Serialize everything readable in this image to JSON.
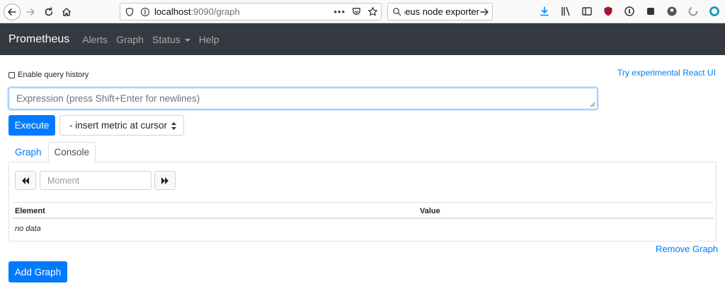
{
  "browser": {
    "url_host": "localhost",
    "url_path": ":9090/graph",
    "url_dots": "•••",
    "search_text": "theus node exporter"
  },
  "navbar": {
    "brand": "Prometheus",
    "links": [
      "Alerts",
      "Graph",
      "Status",
      "Help"
    ]
  },
  "page": {
    "query_history_label": "Enable query history",
    "react_link": "Try experimental React UI",
    "expression_placeholder": "Expression (press Shift+Enter for newlines)",
    "execute_label": "Execute",
    "metric_select_label": "- insert metric at cursor",
    "tabs": [
      "Graph",
      "Console"
    ],
    "active_tab": "Console",
    "moment_placeholder": "Moment",
    "table": {
      "columns": [
        "Element",
        "Value"
      ],
      "empty_text": "no data"
    },
    "remove_graph_label": "Remove Graph",
    "add_graph_label": "Add Graph"
  },
  "colors": {
    "navbar_bg": "#343a40",
    "primary": "#007bff"
  },
  "icons": {
    "back": "back-arrow-icon",
    "forward": "forward-arrow-icon",
    "reload": "reload-icon",
    "home": "home-icon",
    "rewind": "fast-backward-icon",
    "fast_forward": "fast-forward-icon"
  }
}
